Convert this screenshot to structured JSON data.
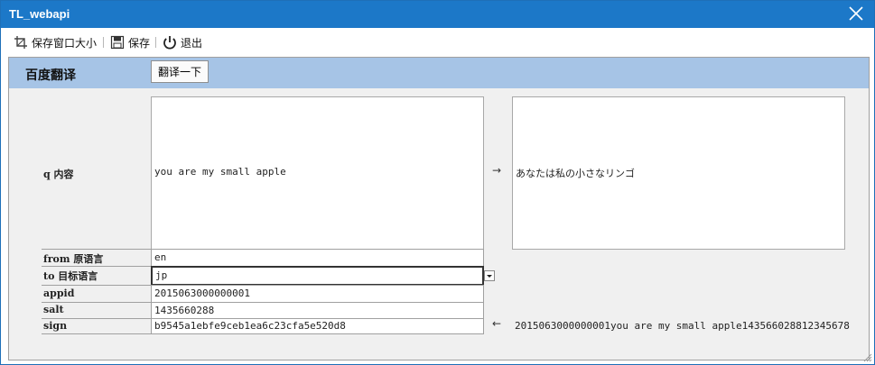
{
  "window": {
    "title": "TL_webapi"
  },
  "toolbar": {
    "save_layout_label": "保存窗口大小",
    "save_label": "保存",
    "exit_label": "退出"
  },
  "panel": {
    "title": "百度翻译",
    "translate_button": "翻译一下"
  },
  "form": {
    "q_label": "q 内容",
    "q_value": "you are my small apple",
    "result_value": "あなたは私の小さなリンゴ",
    "arrow_right": "→",
    "from_label": "from 原语言",
    "from_value": "en",
    "to_label": "to 目标语言",
    "to_value": "jp",
    "appid_label": "appid",
    "appid_value": "2015063000000001",
    "salt_label": "salt",
    "salt_value": "1435660288",
    "sign_label": "sign",
    "sign_value": "b9545a1ebfe9ceb1ea6c23cfa5e520d8",
    "arrow_left": "←",
    "sign_source": "2015063000000001you are my small apple143566028812345678"
  }
}
